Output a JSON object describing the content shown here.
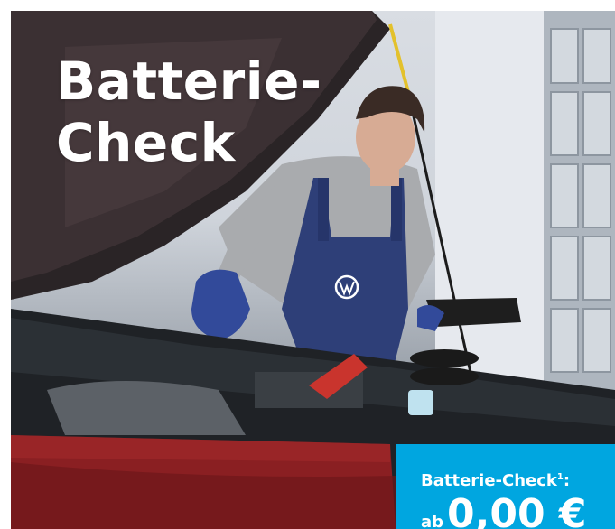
{
  "headline": {
    "line1": "Batterie-",
    "line2": "Check"
  },
  "offer": {
    "label": "Batterie-Check",
    "footnote": "1",
    "label_suffix": ":",
    "price_prefix": "ab",
    "price": "0,00 €"
  },
  "colors": {
    "accent": "#00a6e0",
    "headline": "#ffffff",
    "overalls": "#2e3f78",
    "car_red": "#8a1f22"
  },
  "icons": {
    "brand_logo": "vw-logo-icon"
  }
}
